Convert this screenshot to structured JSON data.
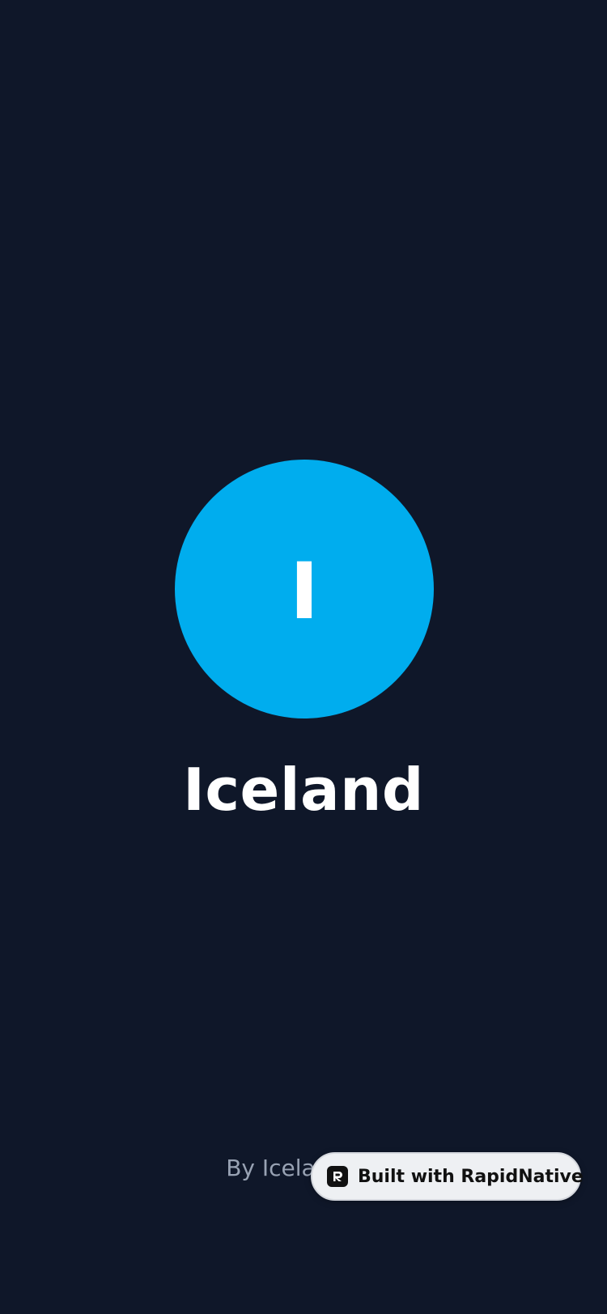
{
  "splash": {
    "logo_letter": "I",
    "app_name": "Iceland",
    "byline": "By Iceland Co"
  },
  "badge": {
    "label": "Built with RapidNative",
    "icon": "rapidnative-logo-icon"
  },
  "colors": {
    "background": "#0f1729",
    "accent": "#00adee",
    "title": "#ffffff",
    "byline": "#98a2b3",
    "badge_bg": "#eef0f3"
  }
}
